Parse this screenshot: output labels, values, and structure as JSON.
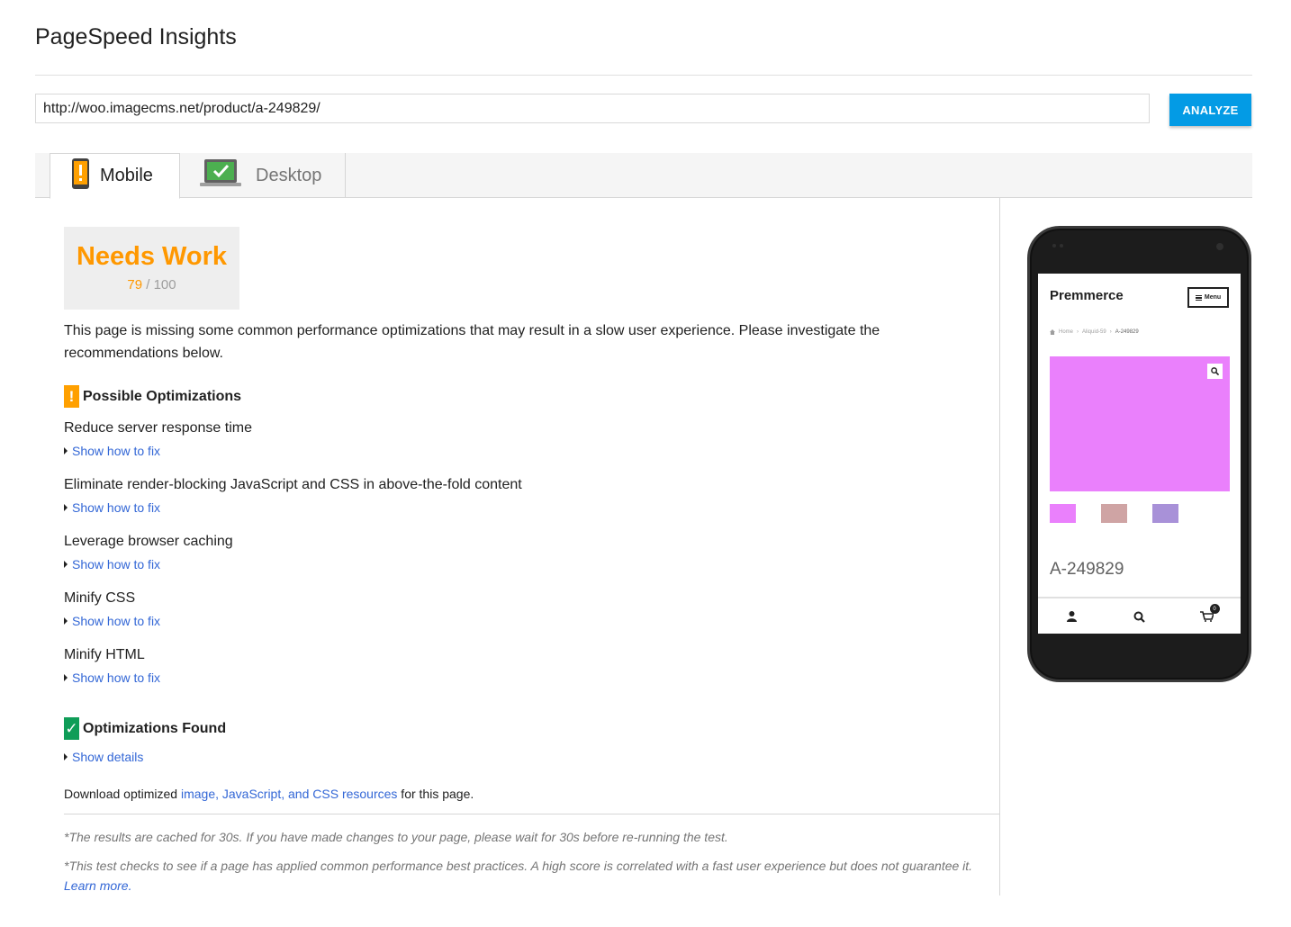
{
  "app_title": "PageSpeed Insights",
  "url_input": {
    "value": "http://woo.imagecms.net/product/a-249829/"
  },
  "analyze_label": "ANALYZE",
  "tabs": [
    {
      "label": "Mobile",
      "active": true,
      "icon": "phone-warning-icon"
    },
    {
      "label": "Desktop",
      "active": false,
      "icon": "laptop-check-icon"
    }
  ],
  "score": {
    "label": "Needs Work",
    "value": "79",
    "separator": "/",
    "max": "100",
    "color": "#ff9800"
  },
  "summary": "This page is missing some common performance optimizations that may result in a slow user experience. Please investigate the recommendations below.",
  "possible_section": {
    "badge": "!",
    "title": "Possible Optimizations",
    "items": [
      {
        "title": "Reduce server response time",
        "link": "Show how to fix"
      },
      {
        "title": "Eliminate render-blocking JavaScript and CSS in above-the-fold content",
        "link": "Show how to fix"
      },
      {
        "title": "Leverage browser caching",
        "link": "Show how to fix"
      },
      {
        "title": "Minify CSS",
        "link": "Show how to fix"
      },
      {
        "title": "Minify HTML",
        "link": "Show how to fix"
      }
    ]
  },
  "found_section": {
    "badge": "✓",
    "title": "Optimizations Found",
    "link": "Show details"
  },
  "download": {
    "prefix": "Download optimized ",
    "link": "image, JavaScript, and CSS resources",
    "suffix": " for this page."
  },
  "notes": {
    "cache": "*The results are cached for 30s. If you have made changes to your page, please wait for 30s before re-running the test.",
    "test": "*This test checks to see if a page has applied common performance best practices. A high score is correlated with a fast user experience but does not guarantee it.",
    "learn_more": "Learn more."
  },
  "preview": {
    "brand": "Premmerce",
    "menu_label": "Menu",
    "breadcrumbs": [
      "Home",
      "Aliquid-59",
      "A-249829"
    ],
    "product_name": "A-249829",
    "cart_count": "0",
    "colors": {
      "hero": "#ea80fc",
      "swatches": [
        "#ea80fc",
        "#cfa4a4",
        "#a891d8"
      ]
    }
  },
  "colors": {
    "accent": "#039be5",
    "warning": "#ffa000",
    "success": "#0f9d58",
    "link": "#3367d6"
  }
}
